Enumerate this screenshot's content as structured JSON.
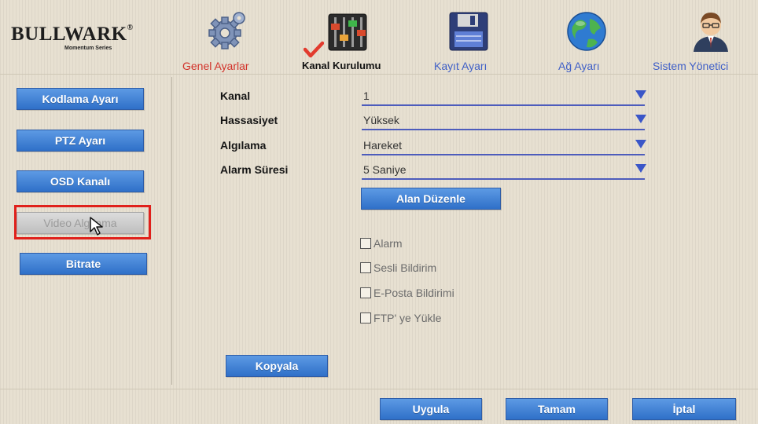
{
  "brand": {
    "name": "BULLWARK",
    "registered": "®",
    "subtitle": "Momentum Series"
  },
  "nav": {
    "tabs": [
      {
        "label": "Genel Ayarlar",
        "icon": "gear-icon"
      },
      {
        "label": "Kanal Kurulumu",
        "icon": "sliders-icon",
        "active": true
      },
      {
        "label": "Kayıt Ayarı",
        "icon": "floppy-disk-icon"
      },
      {
        "label": "Ağ Ayarı",
        "icon": "globe-icon"
      },
      {
        "label": "Sistem Yönetici",
        "icon": "user-icon"
      }
    ]
  },
  "sidebar": {
    "items": [
      {
        "label": "Kodlama Ayarı"
      },
      {
        "label": "PTZ Ayarı"
      },
      {
        "label": "OSD Kanalı"
      },
      {
        "label": "Video Algılama",
        "selected": true
      },
      {
        "label": "Bitrate"
      }
    ]
  },
  "form": {
    "fields": [
      {
        "label": "Kanal",
        "value": "1"
      },
      {
        "label": "Hassasiyet",
        "value": "Yüksek"
      },
      {
        "label": "Algılama",
        "value": "Hareket"
      },
      {
        "label": "Alarm Süresi",
        "value": "5 Saniye"
      }
    ],
    "edit_area_label": "Alan Düzenle",
    "checkboxes": [
      {
        "label": "Alarm",
        "checked": false
      },
      {
        "label": "Sesli Bildirim",
        "checked": false
      },
      {
        "label": "E-Posta Bildirimi",
        "checked": false
      },
      {
        "label": "FTP' ye Yükle",
        "checked": false
      }
    ],
    "copy_label": "Kopyala"
  },
  "footer": {
    "apply_label": "Uygula",
    "ok_label": "Tamam",
    "cancel_label": "İptal"
  },
  "colors": {
    "accent_blue": "#2f70c8",
    "highlight_red": "#e0211b",
    "active_tab_red": "#d2322a",
    "tab_blue": "#3f5fc7"
  }
}
